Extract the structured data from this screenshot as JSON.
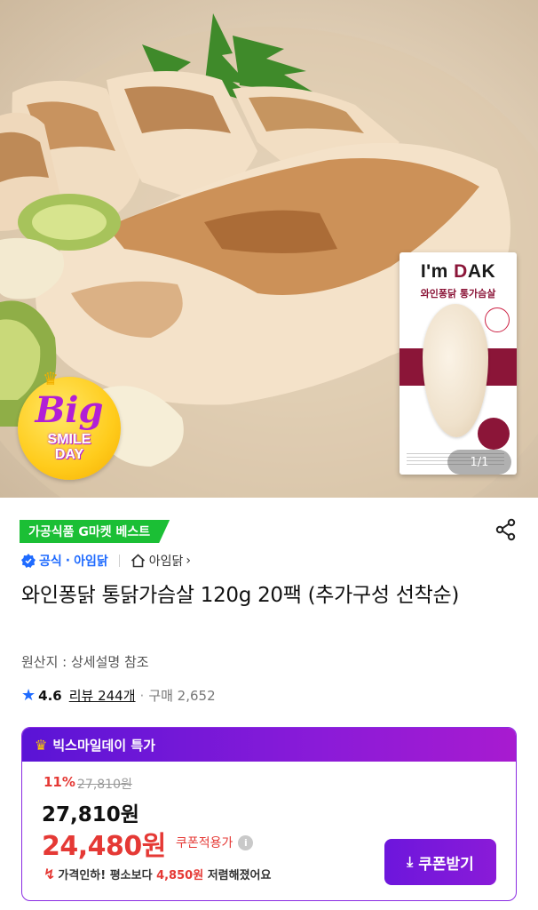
{
  "hero": {
    "image_counter": "1/1",
    "package": {
      "brand_prefix": "I'm ",
      "brand_mark": "D",
      "brand_suffix": "AK",
      "product_name": "와인퐁닭 통가슴살"
    },
    "event_sticker": {
      "big": "Big",
      "smile": "SMILE",
      "day": "DAY"
    }
  },
  "product": {
    "category_badge": "가공식품 G마켓 베스트",
    "official_label": "공식",
    "seller_name": "아임닭",
    "store_link": "아임닭",
    "title": "와인퐁닭 통닭가슴살 120g 20팩 (추가구성 선착순)",
    "origin": "원산지 : 상세설명 참조",
    "rating": "4.6",
    "review_label": "리뷰 244개",
    "purchase_label": "구매 2,652"
  },
  "deal": {
    "header": "빅스마일데이 특가",
    "discount_percent": "11%",
    "original_price": "27,810원",
    "sale_price": "27,810원",
    "coupon_price": "24,480원",
    "coupon_note": "쿠폰적용가",
    "drop_prefix": "가격인하! 평소보다",
    "drop_amount": "4,850원",
    "drop_suffix": "저렴해졌어요",
    "coupon_button": "쿠폰받기"
  },
  "colors": {
    "accent_purple": "#8a1bd8",
    "price_red": "#e53935",
    "official_blue": "#1f6bff",
    "best_green": "#1bbf35"
  }
}
